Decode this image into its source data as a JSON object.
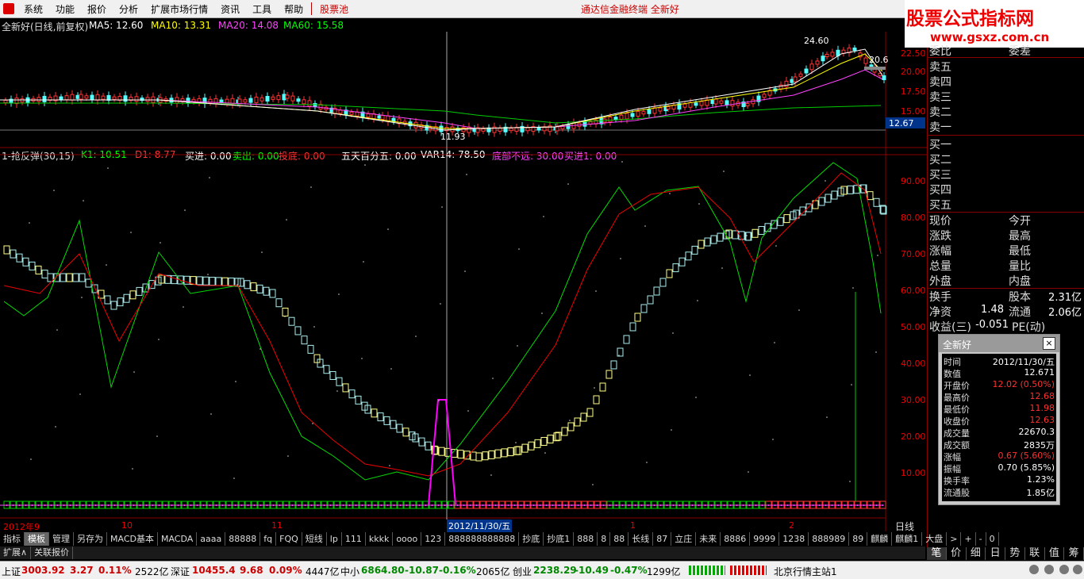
{
  "menu": {
    "items": [
      "系统",
      "功能",
      "报价",
      "分析",
      "扩展市场行情",
      "资讯",
      "工具",
      "帮助"
    ],
    "highlight": "股票池",
    "center_title": "通达信金融终端   全新好"
  },
  "logo": {
    "text": "股票公式指标网",
    "url": "www.gsxz.com.cn"
  },
  "main_chart": {
    "name": "全新好(日线,前复权)",
    "ma": [
      {
        "label": "MA5: 12.60",
        "color": "#ffffff"
      },
      {
        "label": "MA10: 13.31",
        "color": "#ffff00"
      },
      {
        "label": "MA20: 14.08",
        "color": "#ff40ff"
      },
      {
        "label": "MA60: 15.58",
        "color": "#00ff00"
      }
    ],
    "price_axis": [
      "22.50",
      "20.00",
      "17.50",
      "15.00",
      "12.67"
    ],
    "annotations": {
      "high": "24.60",
      "low": "11.93",
      "right": "20.6"
    }
  },
  "indicator": {
    "name": "1-抢反弹(30,15)",
    "fields": [
      {
        "label": "K1: 10.51",
        "color": "#00ff00"
      },
      {
        "label": "D1: 8.77",
        "color": "#ff3030"
      },
      {
        "label": "买进: 0.00",
        "color": "#ffffff"
      },
      {
        "label": "卖出: 0.00",
        "color": "#00ff00"
      },
      {
        "label": "投底: 0.00",
        "color": "#ff3030"
      },
      {
        "label": "五天百分五: 0.00",
        "color": "#ffffff"
      },
      {
        "label": "VAR14: 78.50",
        "color": "#ffffff"
      },
      {
        "label": "底部不远: 30.00",
        "color": "#ff40ff"
      },
      {
        "label": "买进1: 0.00",
        "color": "#ff40ff"
      }
    ],
    "axis": [
      "90.00",
      "80.00",
      "70.00",
      "60.00",
      "50.00",
      "40.00",
      "30.00",
      "20.00",
      "10.00"
    ]
  },
  "date_axis": {
    "labels": [
      "2012年9",
      "10",
      "11",
      "1",
      "2"
    ],
    "cursor": "2012/11/30/五",
    "period": "日线"
  },
  "right_panel": {
    "header": {
      "l": "委比",
      "r": "委差"
    },
    "sell": [
      "卖五",
      "卖四",
      "卖三",
      "卖二",
      "卖一"
    ],
    "buy": [
      "买一",
      "买二",
      "买三",
      "买四",
      "买五"
    ],
    "stats": [
      {
        "l": "现价",
        "m": "今开"
      },
      {
        "l": "涨跌",
        "m": "最高"
      },
      {
        "l": "涨幅",
        "m": "最低"
      },
      {
        "l": "总量",
        "m": "量比"
      },
      {
        "l": "外盘",
        "m": "内盘"
      }
    ],
    "extra": [
      {
        "l": "换手",
        "m": "股本",
        "v": "2.31亿"
      },
      {
        "l": "净资",
        "v1": "1.48",
        "m": "流通",
        "v": "2.06亿"
      },
      {
        "l": "收益(三)",
        "v1": "-0.051",
        "m": "PE(动)",
        "v": ""
      }
    ]
  },
  "popup": {
    "title": "全新好",
    "rows": [
      {
        "k": "时间",
        "v": "2012/11/30/五",
        "c": "#ffffff"
      },
      {
        "k": "数值",
        "v": "12.671",
        "c": "#ffffff"
      },
      {
        "k": "开盘价",
        "v": "12.02 (0.50%)",
        "c": "#ff3030"
      },
      {
        "k": "最高价",
        "v": "12.68",
        "c": "#ff3030"
      },
      {
        "k": "最低价",
        "v": "11.98",
        "c": "#ff3030"
      },
      {
        "k": "收盘价",
        "v": "12.63",
        "c": "#ff3030"
      },
      {
        "k": "成交量",
        "v": "22670.3",
        "c": "#ffffff"
      },
      {
        "k": "成交额",
        "v": "2835万",
        "c": "#ffffff"
      },
      {
        "k": "涨幅",
        "v": "0.67 (5.60%)",
        "c": "#ff3030"
      },
      {
        "k": "振幅",
        "v": "0.70 (5.85%)",
        "c": "#ffffff"
      },
      {
        "k": "换手率",
        "v": "1.23%",
        "c": "#ffffff"
      },
      {
        "k": "流通股",
        "v": "1.85亿",
        "c": "#ffffff"
      }
    ]
  },
  "tabs": [
    "指标",
    "模板",
    "管理",
    "另存为",
    "MACD基本",
    "MACDA",
    "aaaa",
    "88888",
    "fq",
    "FQQ",
    "短线",
    "lp",
    "111",
    "kkkk",
    "oooo",
    "123",
    "888888888888",
    "抄底",
    "抄底1",
    "888",
    "8",
    "88",
    "长线",
    "87",
    "立庄",
    "未来",
    "8886",
    "9999",
    "1238",
    "888989",
    "89",
    "麒麟",
    "麒麟1",
    "大盘",
    ">",
    "+",
    "-",
    "0"
  ],
  "tabs_selected": "模板",
  "tabs2": [
    "扩展∧",
    "关联报价"
  ],
  "right_tabs": [
    "笔",
    "价",
    "细",
    "日",
    "势",
    "联",
    "值",
    "筹"
  ],
  "status": {
    "sh_label": "上证",
    "sh_val": "3003.92",
    "sh_chg": "3.27",
    "sh_pct": "0.11%",
    "sh_amt": "2522亿",
    "sz_label": "深证",
    "sz_val": "10455.4",
    "sz_chg": "9.68",
    "sz_pct": "0.09%",
    "sz_amt": "4447亿",
    "zx_label": "中小",
    "zx_val": "6864.80",
    "zx_chg": "-10.87",
    "zx_pct": "-0.16%",
    "zx_amt": "2065亿",
    "cy_label": "创业",
    "cy_val": "2238.29",
    "cy_chg": "-10.49",
    "cy_pct": "-0.47%",
    "cy_amt": "1299亿",
    "server": "北京行情主站1"
  }
}
